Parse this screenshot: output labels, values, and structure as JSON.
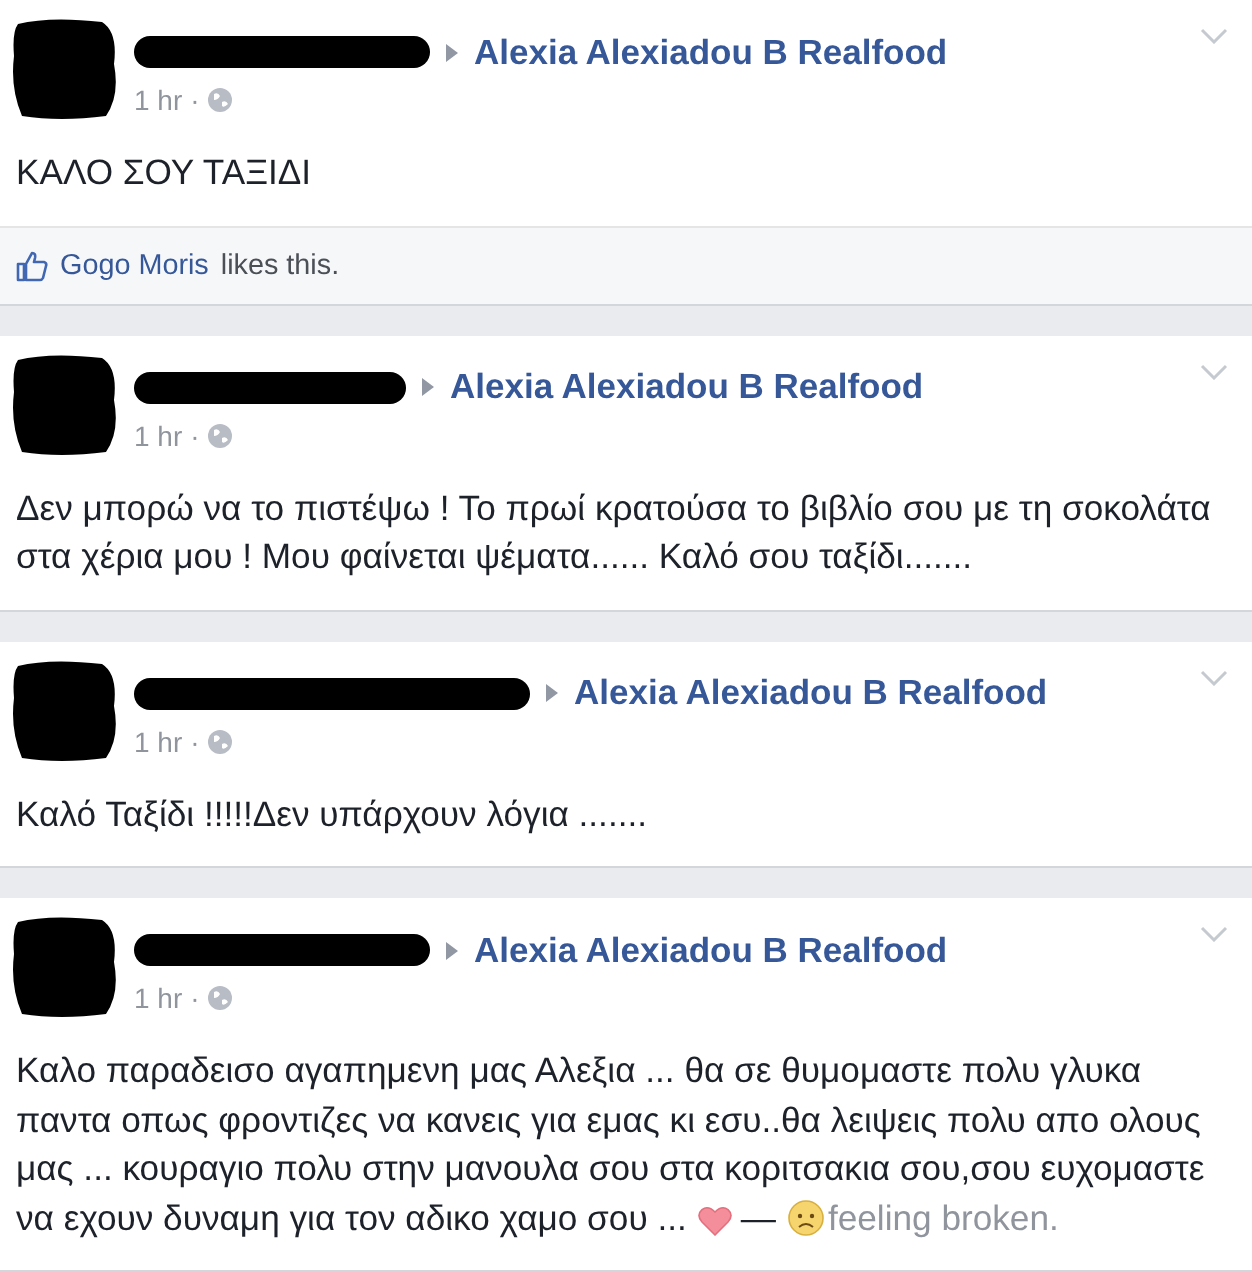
{
  "posts": [
    {
      "target": "Alexia Alexiadou B Realfood",
      "time": "1 hr",
      "separator": "·",
      "text": "ΚΑΛΟ ΣΟΥ ΤΑΞΙΔΙ",
      "likes": {
        "name": "Gogo Moris",
        "rest": "likes this."
      }
    },
    {
      "target": "Alexia Alexiadou B Realfood",
      "time": "1 hr",
      "separator": "·",
      "text": "Δεν μπορώ να το πιστέψω ! Το πρωί κρατούσα το βιβλίο σου με τη σοκολάτα στα χέρια μου ! Μου φαίνεται ψέματα...... Καλό σου ταξίδι......."
    },
    {
      "target": "Alexia Alexiadou B Realfood",
      "time": "1 hr",
      "separator": "·",
      "text": "Καλό Ταξίδι !!!!!Δεν υπάρχουν λόγια ......."
    },
    {
      "target": "Alexia Alexiadou B Realfood",
      "time": "1 hr",
      "separator": "·",
      "text": "Καλο παραδεισο αγαπημενη μας Αλεξια ... θα σε θυμομαστε πολυ γλυκα παντα οπως φροντιζες να κανεις για εμας κι εσυ..θα λειψεις πολυ απο ολους μας ... κουραγιο πολυ στην μανουλα σου στα κοριτσακια σου,σου ευχομαστε να εχουν δυναμη για τον αδικο χαμο σου ...",
      "feeling": {
        "dash": "—",
        "text": "feeling broken."
      }
    }
  ]
}
